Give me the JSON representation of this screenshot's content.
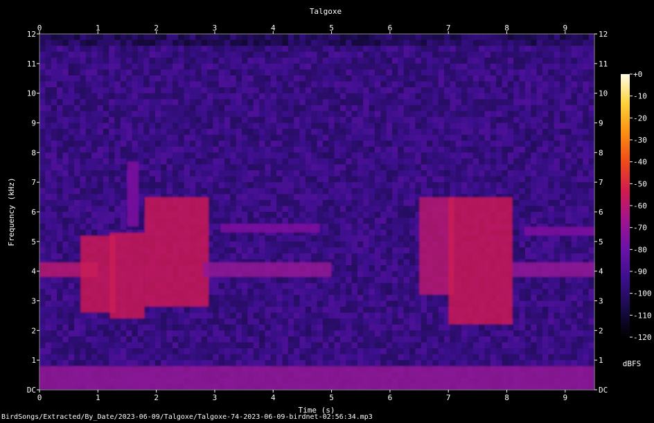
{
  "chart_data": {
    "type": "heatmap",
    "title": "Talgoxe",
    "xlabel": "Time (s)",
    "ylabel": "Frequency (kHz)",
    "xlim": [
      0,
      9.5
    ],
    "ylim": [
      0,
      12
    ],
    "x_ticks": [
      "0",
      "1",
      "2",
      "3",
      "4",
      "5",
      "6",
      "7",
      "8",
      "9"
    ],
    "y_ticks": [
      "DC",
      "1",
      "2",
      "3",
      "4",
      "5",
      "6",
      "7",
      "8",
      "9",
      "10",
      "11",
      "12"
    ],
    "colorbar": {
      "label": "dBFS",
      "range": [
        -120,
        0
      ],
      "ticks": [
        "+0",
        "-10",
        "-20",
        "-30",
        "-40",
        "-50",
        "-60",
        "-70",
        "-80",
        "-90",
        "-100",
        "-110",
        "-120"
      ],
      "colors": [
        "#000000",
        "#1a0b4a",
        "#3b0f8c",
        "#6a12a8",
        "#a0148f",
        "#d01b4e",
        "#f04a1a",
        "#fb8f12",
        "#fcd23a",
        "#fffde8"
      ]
    },
    "background_level_dbfs": -95,
    "noise_ceiling_khz": 11.5,
    "events": [
      {
        "t0": 0.0,
        "t1": 1.0,
        "f0": 3.8,
        "f1": 4.3,
        "level_dbfs": -60
      },
      {
        "t0": 0.7,
        "t1": 1.3,
        "f0": 2.6,
        "f1": 5.2,
        "level_dbfs": -55
      },
      {
        "t0": 1.2,
        "t1": 1.8,
        "f0": 2.4,
        "f1": 5.3,
        "level_dbfs": -55
      },
      {
        "t0": 1.5,
        "t1": 1.7,
        "f0": 5.5,
        "f1": 7.7,
        "level_dbfs": -75
      },
      {
        "t0": 1.8,
        "t1": 2.9,
        "f0": 2.8,
        "f1": 6.5,
        "level_dbfs": -55
      },
      {
        "t0": 2.8,
        "t1": 5.0,
        "f0": 3.8,
        "f1": 4.3,
        "level_dbfs": -70
      },
      {
        "t0": 3.1,
        "t1": 4.8,
        "f0": 5.3,
        "f1": 5.6,
        "level_dbfs": -75
      },
      {
        "t0": 6.5,
        "t1": 7.1,
        "f0": 3.2,
        "f1": 6.5,
        "level_dbfs": -60
      },
      {
        "t0": 7.0,
        "t1": 8.1,
        "f0": 2.2,
        "f1": 6.5,
        "level_dbfs": -55
      },
      {
        "t0": 8.1,
        "t1": 9.5,
        "f0": 3.8,
        "f1": 4.3,
        "level_dbfs": -70
      },
      {
        "t0": 8.3,
        "t1": 9.5,
        "f0": 5.2,
        "f1": 5.5,
        "level_dbfs": -75
      },
      {
        "t0": 0.0,
        "t1": 9.5,
        "f0": 0.0,
        "f1": 0.8,
        "level_dbfs": -70
      }
    ]
  },
  "footer": {
    "file_path": "BirdSongs/Extracted/By_Date/2023-06-09/Talgoxe/Talgoxe-74-2023-06-09-birdnet-02:56:34.mp3"
  }
}
